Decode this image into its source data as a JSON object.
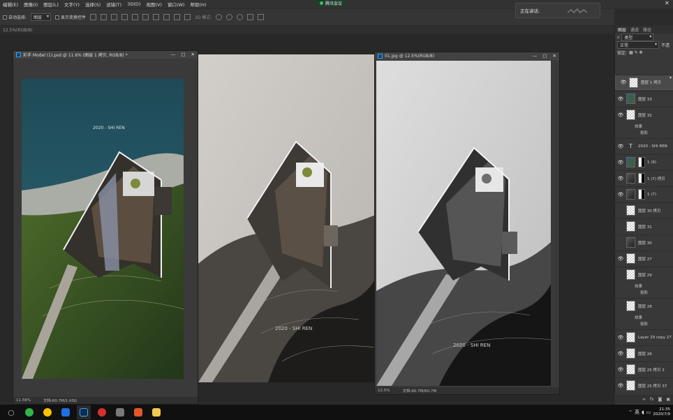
{
  "menubar": {
    "items": [
      "编辑(E)",
      "图像(I)",
      "图层(L)",
      "文字(Y)",
      "选择(S)",
      "滤镜(T)",
      "3D(D)",
      "视图(V)",
      "窗口(W)",
      "帮助(H)"
    ],
    "meeting_label": "腾讯会议",
    "speaking_label": "正在讲话:"
  },
  "options": {
    "auto_select_label": "自动选择:",
    "auto_select_value": "图层",
    "show_transform_label": "显示变换控件",
    "mode_3d_label": "3D 模式:"
  },
  "tabstrip": {
    "label": "12.5%(RGB/8)"
  },
  "doc1": {
    "title": "彩手 Model (1).psd @ 11.6% (图层 1 拷贝, RGB/8) *",
    "caption": "2020 - SHI REN",
    "zoom": "11.56%",
    "docsize": "文档:60.7M/1.43G"
  },
  "doc2": {
    "caption": "2020 - SHI REN"
  },
  "doc3": {
    "title": "01.jpg @ 12.5%(RGB/8)",
    "caption": "2020 - SHI REN",
    "zoom": "12.5%",
    "docsize": "文档:60.7M/60.7M"
  },
  "panel": {
    "tabs": [
      "图层",
      "通道",
      "路径"
    ],
    "kind_value": "类型",
    "blend_value": "正常",
    "opacity_label": "不透",
    "lock_label": "锁定:",
    "layers": [
      {
        "name": "图层 1 拷贝",
        "eye": true,
        "thumb": "checker",
        "sel": true
      },
      {
        "name": "图层 33",
        "eye": true,
        "thumb": "img"
      },
      {
        "name": "图层 32",
        "eye": true,
        "thumb": "checker"
      },
      {
        "name": "2020 - SHI REN",
        "eye": true,
        "thumb": "text"
      },
      {
        "name": "1 (9)",
        "eye": true,
        "thumb": "img",
        "mask": true
      },
      {
        "name": "1 (7) 拷贝",
        "eye": true,
        "thumb": "dark",
        "mask": true
      },
      {
        "name": "1 (7)",
        "eye": true,
        "thumb": "dark",
        "mask": true
      },
      {
        "name": "图层 30 拷贝",
        "eye": false,
        "thumb": "checker"
      },
      {
        "name": "图层 31",
        "eye": false,
        "thumb": "checker"
      },
      {
        "name": "图层 30",
        "eye": false,
        "thumb": "dark"
      },
      {
        "name": "图层 27",
        "eye": true,
        "thumb": "checker"
      },
      {
        "name": "图层 29",
        "eye": false,
        "thumb": "checker"
      },
      {
        "name": "图层 28",
        "eye": false,
        "thumb": "checker"
      },
      {
        "name": "Layer 29 copy 27",
        "eye": true,
        "thumb": "checker"
      },
      {
        "name": "图层 26",
        "eye": true,
        "thumb": "checker"
      },
      {
        "name": "图层 25 拷贝 2",
        "eye": true,
        "thumb": "checker"
      },
      {
        "name": "图层 25 拷贝 37",
        "eye": true,
        "thumb": "checker"
      }
    ],
    "effects_label": "效果",
    "shadow_label": "投影"
  },
  "taskbar": {
    "time": "21:35",
    "date": "2020/7/9",
    "ime": "英"
  }
}
